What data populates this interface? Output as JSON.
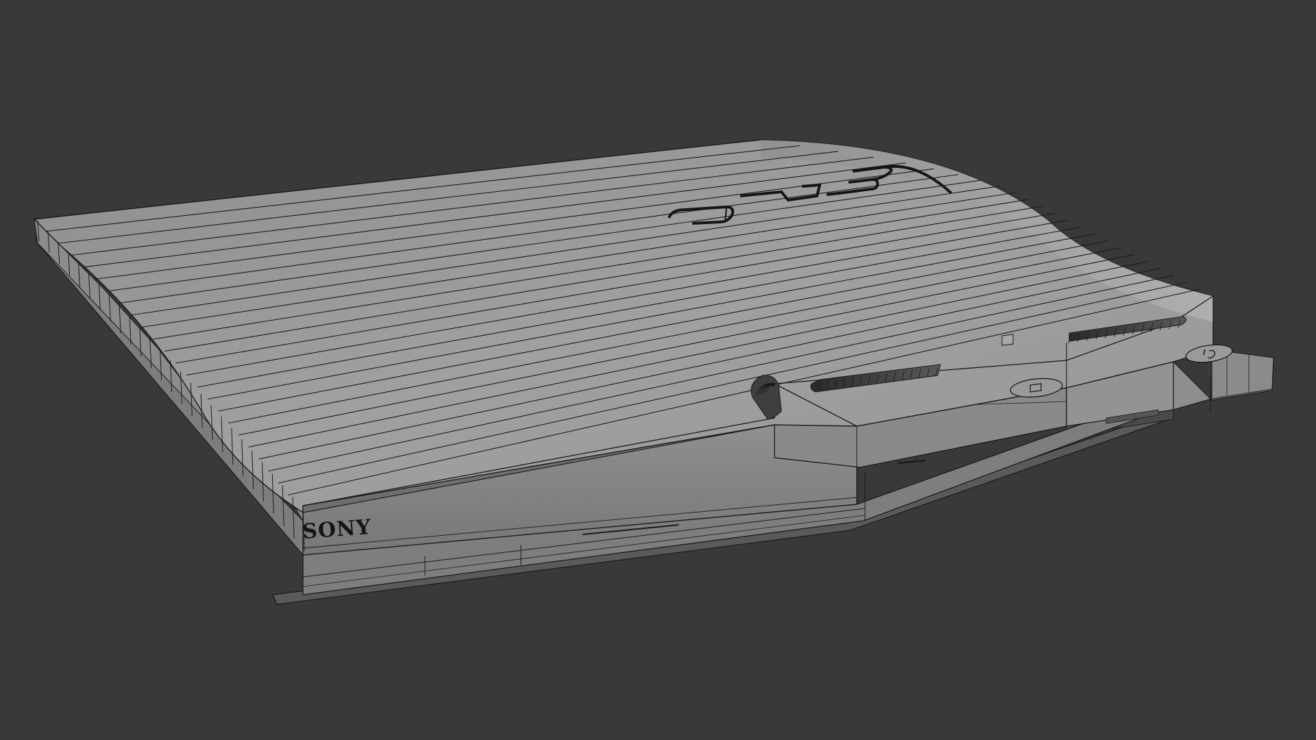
{
  "scene": {
    "background_color": "#393939",
    "model_fill_light": "#9a9a9a",
    "model_fill_mid": "#8a8a8a",
    "model_fill_dark": "#737373",
    "wire_color": "#1a1a1a",
    "subject": "wireframe-slim-game-console"
  },
  "front_panel": {
    "brand_label": "SONY"
  },
  "top_panel": {
    "logo_icon": "ps3-logo-icon"
  },
  "controls": {
    "eject_icon": "eject-icon",
    "power_icon": "power-icon",
    "led_icon": "indicator-led-icon"
  }
}
